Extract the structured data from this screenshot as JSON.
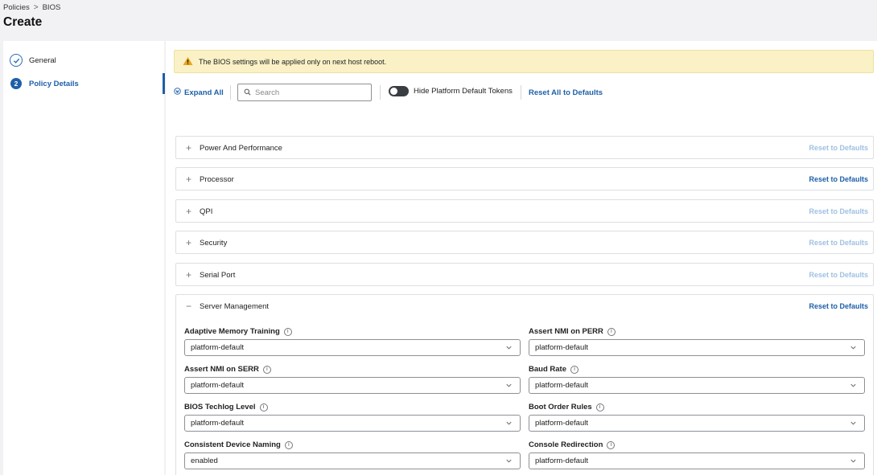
{
  "breadcrumb": {
    "items": [
      "Policies",
      "BIOS"
    ],
    "separator": ">"
  },
  "page_title": "Create",
  "steps": [
    {
      "label": "General",
      "state": "done",
      "icon": "check-icon"
    },
    {
      "label": "Policy Details",
      "number": "2",
      "state": "active"
    }
  ],
  "banner": {
    "text": "The BIOS settings will be applied only on next host reboot.",
    "icon": "warning-icon",
    "color": "#faf1c6"
  },
  "toolbar": {
    "expand_all": "Expand All",
    "search_placeholder": "Search",
    "search_value": "",
    "toggle_label": "Hide Platform Default Tokens",
    "toggle_on": false,
    "reset_all": "Reset All to Defaults"
  },
  "sections": [
    {
      "title": "Power And Performance",
      "expanded": false,
      "reset": "Reset to Defaults",
      "reset_enabled": false
    },
    {
      "title": "Processor",
      "expanded": false,
      "reset": "Reset to Defaults",
      "reset_enabled": true
    },
    {
      "title": "QPI",
      "expanded": false,
      "reset": "Reset to Defaults",
      "reset_enabled": false
    },
    {
      "title": "Security",
      "expanded": false,
      "reset": "Reset to Defaults",
      "reset_enabled": false
    },
    {
      "title": "Serial Port",
      "expanded": false,
      "reset": "Reset to Defaults",
      "reset_enabled": false
    },
    {
      "title": "Server Management",
      "expanded": true,
      "reset": "Reset to Defaults",
      "reset_enabled": true
    }
  ],
  "server_management_fields": [
    {
      "label": "Adaptive Memory Training",
      "value": "platform-default"
    },
    {
      "label": "Assert NMI on PERR",
      "value": "platform-default"
    },
    {
      "label": "Assert NMI on SERR",
      "value": "platform-default"
    },
    {
      "label": "Baud Rate",
      "value": "platform-default"
    },
    {
      "label": "BIOS Techlog Level",
      "value": "platform-default"
    },
    {
      "label": "Boot Order Rules",
      "value": "platform-default"
    },
    {
      "label": "Consistent Device Naming",
      "value": "enabled"
    },
    {
      "label": "Console Redirection",
      "value": "platform-default"
    }
  ],
  "colors": {
    "accent": "#1d5fa8",
    "accent_disabled": "#9fc0e3",
    "warning": "#e8a317"
  }
}
